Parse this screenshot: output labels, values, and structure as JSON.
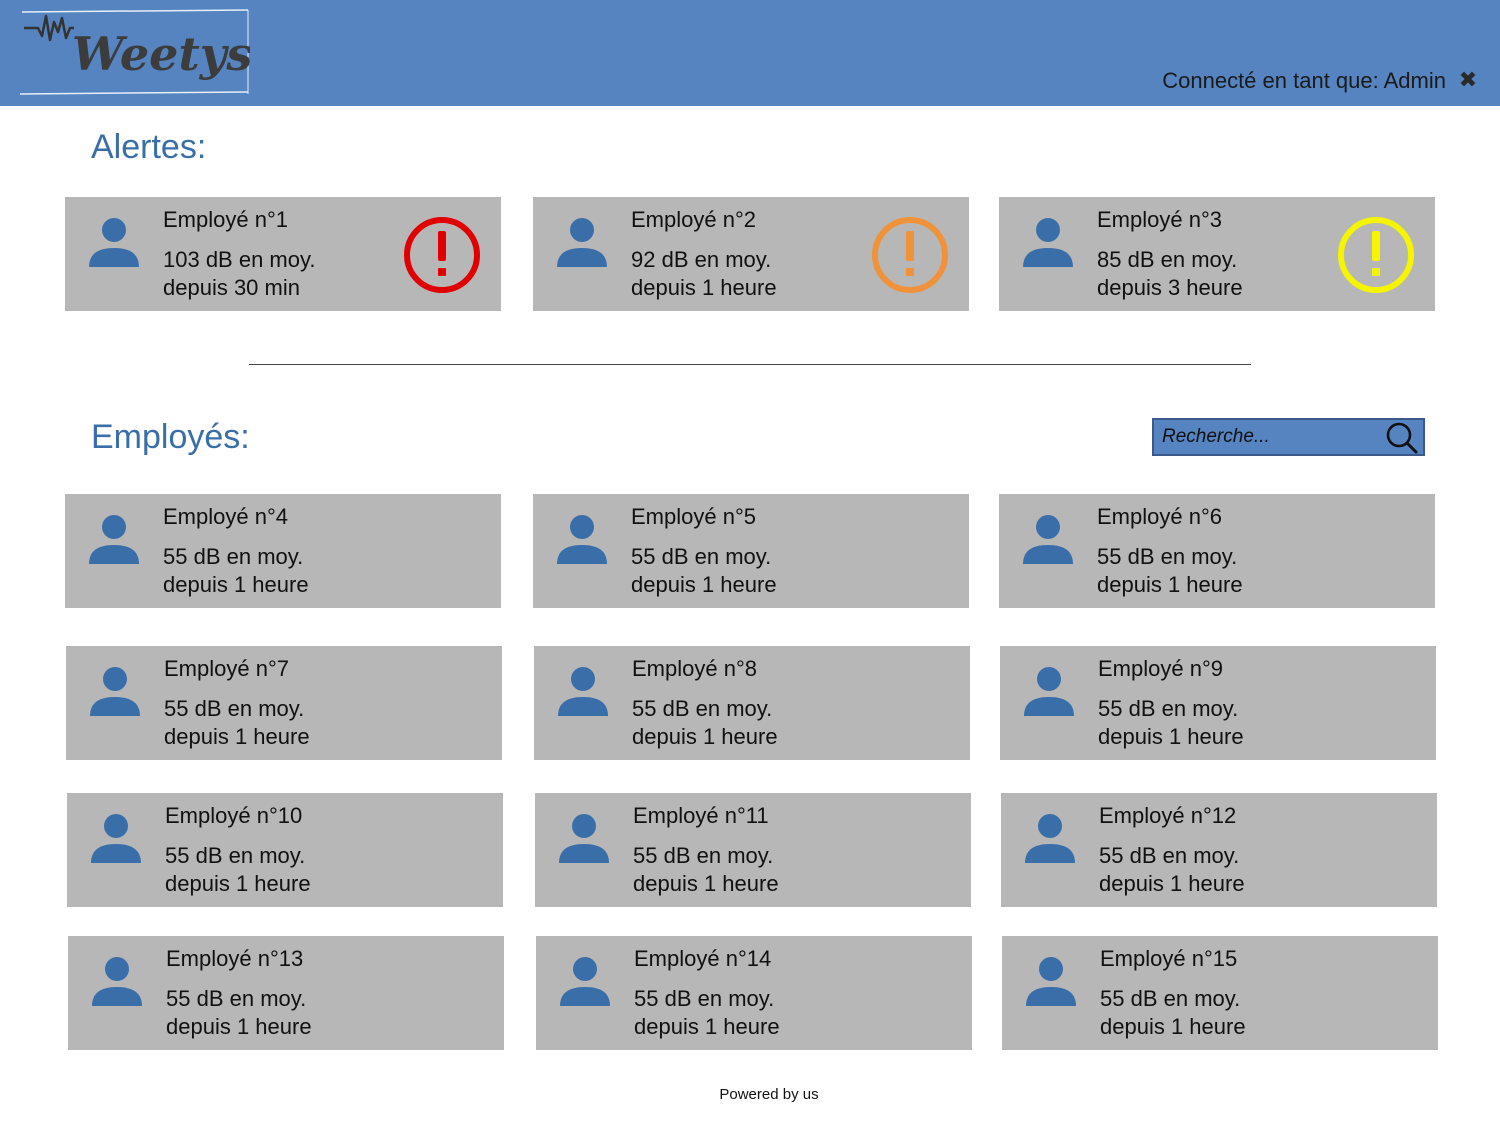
{
  "header": {
    "logo_text": "Weetys",
    "user_label": "Connecté en tant que: Admin",
    "logout_icon": "close-icon"
  },
  "alerts": {
    "title": "Alertes:",
    "cards": [
      {
        "name": "Employé n°1",
        "level": "103 dB en moy.",
        "since": "depuis 30 min",
        "severity_color": "#e00000"
      },
      {
        "name": "Employé n°2",
        "level": "92 dB en moy.",
        "since": "depuis 1 heure",
        "severity_color": "#f0923a"
      },
      {
        "name": "Employé n°3",
        "level": "85 dB en moy.",
        "since": "depuis 3 heure",
        "severity_color": "#f5f500"
      }
    ]
  },
  "employees": {
    "title": "Employés:",
    "search_placeholder": "Recherche...",
    "cards": [
      {
        "name": "Employé n°4",
        "level": "55 dB en moy.",
        "since": "depuis 1 heure"
      },
      {
        "name": "Employé n°5",
        "level": "55 dB en moy.",
        "since": "depuis 1 heure"
      },
      {
        "name": "Employé n°6",
        "level": "55 dB en moy.",
        "since": "depuis 1 heure"
      },
      {
        "name": "Employé n°7",
        "level": "55 dB en moy.",
        "since": "depuis 1 heure"
      },
      {
        "name": "Employé n°8",
        "level": "55 dB en moy.",
        "since": "depuis 1 heure"
      },
      {
        "name": "Employé n°9",
        "level": "55 dB en moy.",
        "since": "depuis 1 heure"
      },
      {
        "name": "Employé n°10",
        "level": "55 dB en moy.",
        "since": "depuis 1 heure"
      },
      {
        "name": "Employé n°11",
        "level": "55 dB en moy.",
        "since": "depuis 1 heure"
      },
      {
        "name": "Employé n°12",
        "level": "55 dB en moy.",
        "since": "depuis 1 heure"
      },
      {
        "name": "Employé n°13",
        "level": "55 dB en moy.",
        "since": "depuis 1 heure"
      },
      {
        "name": "Employé n°14",
        "level": "55 dB en moy.",
        "since": "depuis 1 heure"
      },
      {
        "name": "Employé n°15",
        "level": "55 dB en moy.",
        "since": "depuis 1 heure"
      }
    ]
  },
  "colors": {
    "header_bg": "#5584c0",
    "title": "#3a6ea8",
    "card_bg": "#b7b7b7",
    "avatar": "#3a6ea8"
  },
  "footer": {
    "text": "Powered by us"
  }
}
